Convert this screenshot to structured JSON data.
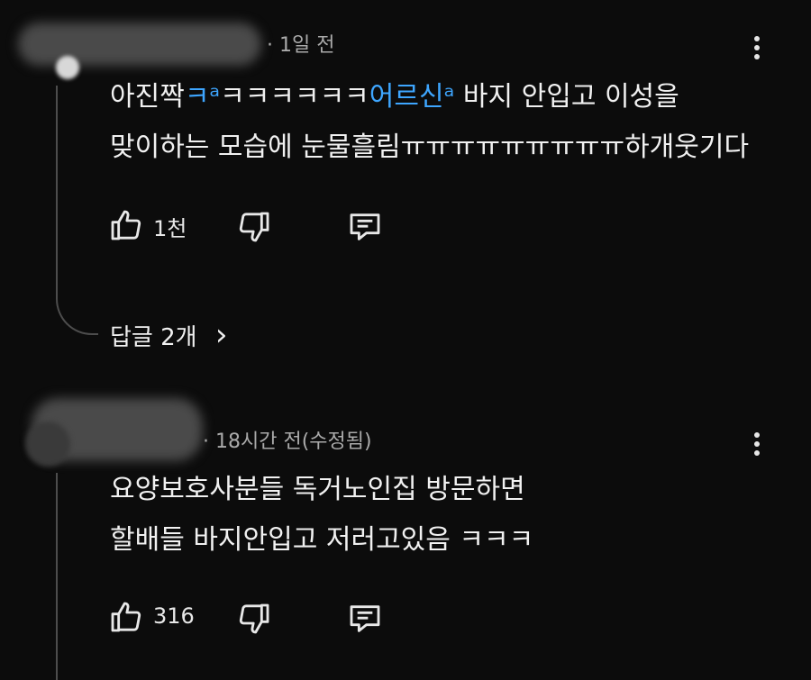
{
  "comments": [
    {
      "meta": "· 1일 전",
      "text_parts": [
        {
          "text": "아진짝"
        },
        {
          "text": "ㅋᵃ",
          "link": true
        },
        {
          "text": "ㅋㅋㅋㅋㅋㅋ"
        },
        {
          "text": "어르신ᵃ",
          "link": true
        },
        {
          "text": " 바지 안입고 이성을"
        }
      ],
      "text_line2": "맞이하는 모습에 눈물흘림ㅠㅠㅠㅠㅠㅠㅠㅠㅠ하개웃기다",
      "likes": "1천",
      "replies_label": "답글 2개",
      "replies_chevron": "›"
    },
    {
      "meta": "· 18시간 전(수정됨)",
      "text_line1": "요양보호사분들 독거노인집 방문하면",
      "text_line2": "할배들 바지안입고 저러고있음 ㅋㅋㅋ",
      "likes": "316"
    }
  ],
  "icons": {
    "like": "thumb-up-icon",
    "dislike": "thumb-down-icon",
    "reply": "comment-icon",
    "more": "more-vert-icon"
  },
  "colors": {
    "background": "#0c0c0c",
    "text": "#f1f1f1",
    "meta": "#aaaaaa",
    "link": "#3ea6ff"
  }
}
